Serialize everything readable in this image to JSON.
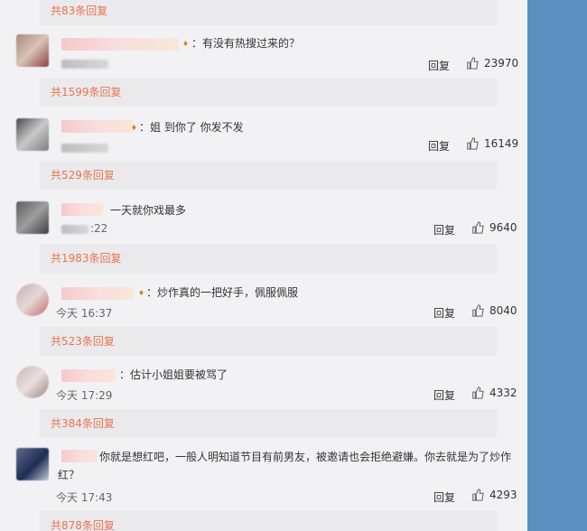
{
  "comments": [
    {
      "id": 1,
      "text": "：有没有热搜过来的？",
      "time": "",
      "likes": "23970",
      "reply": "回复",
      "subreplies": "共1599条回复"
    },
    {
      "id": 2,
      "text": "：姐 到你了 你发不发",
      "time": "",
      "likes": "16149",
      "reply": "回复",
      "subreplies": "共529条回复"
    },
    {
      "id": 3,
      "text": "一天就你戏最多",
      "time": ":22",
      "likes": "9640",
      "reply": "回复",
      "subreplies": "共1983条回复"
    },
    {
      "id": 4,
      "text": "：炒作真的一把好手，佩服佩服",
      "time": "今天 16:37",
      "likes": "8040",
      "reply": "回复",
      "subreplies": "共523条回复"
    },
    {
      "id": 5,
      "text": "：估计小姐姐要被骂了",
      "time": "今天 17:29",
      "likes": "4332",
      "reply": "回复",
      "subreplies": "共384条回复"
    },
    {
      "id": 6,
      "text_line1": "你就是想红吧，一般人明知道节目有前男友，被邀请也会拒绝避嫌。你去就是为了炒作",
      "text_line2": "红？",
      "time": "今天 17:43",
      "likes": "4293",
      "reply": "回复",
      "subreplies": "共878条回复"
    }
  ],
  "top_bar": {
    "subreplies": "共83条回复"
  },
  "icons": {
    "like": "thumbs-up-icon",
    "vip": "vip-badge-icon"
  },
  "colors": {
    "link": "#eb7350",
    "sidebar": "#5b8fc0"
  }
}
